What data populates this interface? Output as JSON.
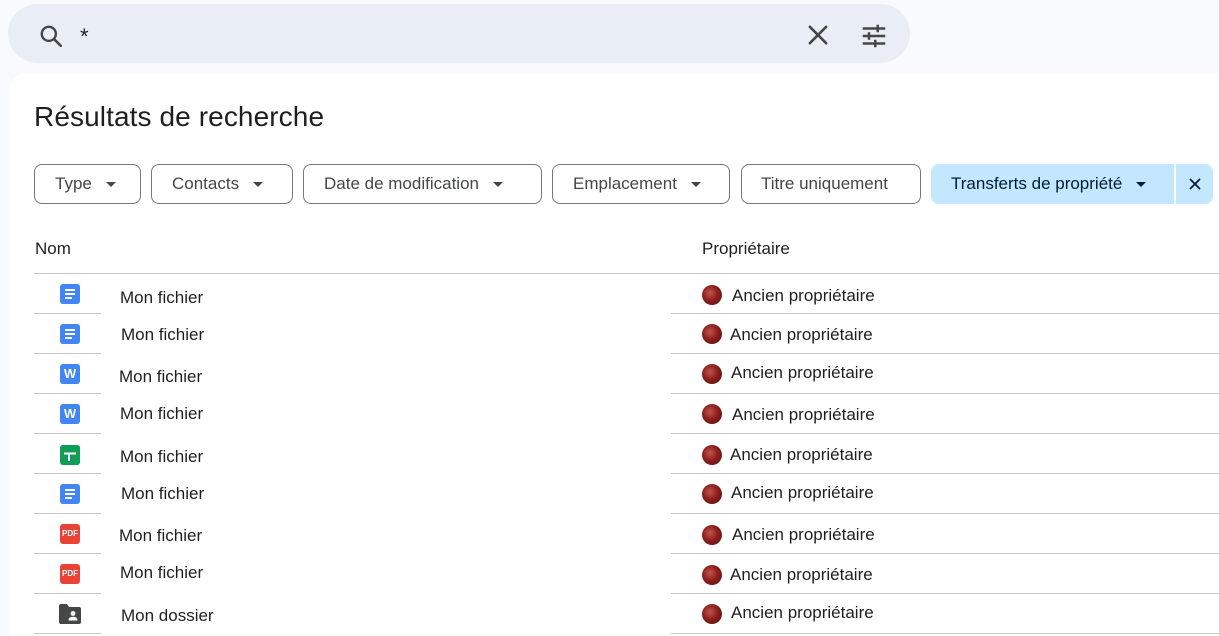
{
  "search": {
    "query": "*"
  },
  "page": {
    "title": "Résultats de recherche"
  },
  "filters": [
    {
      "label": "Type",
      "dropdown": true
    },
    {
      "label": "Contacts",
      "dropdown": true
    },
    {
      "label": "Date de modification",
      "dropdown": true
    },
    {
      "label": "Emplacement",
      "dropdown": true
    },
    {
      "label": "Titre uniquement",
      "dropdown": false
    },
    {
      "label": "Transferts de propriété",
      "dropdown": true,
      "active": true
    }
  ],
  "columns": {
    "name": "Nom",
    "owner": "Propriétaire"
  },
  "rows": [
    {
      "icon": "google-docs-icon",
      "name": "Mon fichier",
      "owner": "Ancien propriétaire"
    },
    {
      "icon": "google-docs-icon",
      "name": "Mon fichier",
      "owner": "Ancien propriétaire"
    },
    {
      "icon": "word-icon",
      "icon_text": "W",
      "name": "Mon fichier",
      "owner": "Ancien propriétaire"
    },
    {
      "icon": "word-icon",
      "icon_text": "W",
      "name": "Mon fichier",
      "owner": "Ancien propriétaire"
    },
    {
      "icon": "google-sheets-icon",
      "name": "Mon fichier",
      "owner": "Ancien propriétaire"
    },
    {
      "icon": "google-docs-icon",
      "name": "Mon fichier",
      "owner": "Ancien propriétaire"
    },
    {
      "icon": "pdf-icon",
      "icon_text": "PDF",
      "name": "Mon fichier",
      "owner": "Ancien propriétaire"
    },
    {
      "icon": "pdf-icon",
      "icon_text": "PDF",
      "name": "Mon fichier",
      "owner": "Ancien propriétaire"
    },
    {
      "icon": "shared-folder-icon",
      "name": "Mon dossier",
      "owner": "Ancien propriétaire"
    }
  ],
  "colors": {
    "background": "#f8fafd",
    "search_bg": "#e9eef6",
    "active_chip": "#c2e7ff",
    "docs_blue": "#4285f4",
    "sheets_green": "#0f9d58",
    "pdf_red": "#ea4335",
    "avatar": "#8b1f1d"
  }
}
